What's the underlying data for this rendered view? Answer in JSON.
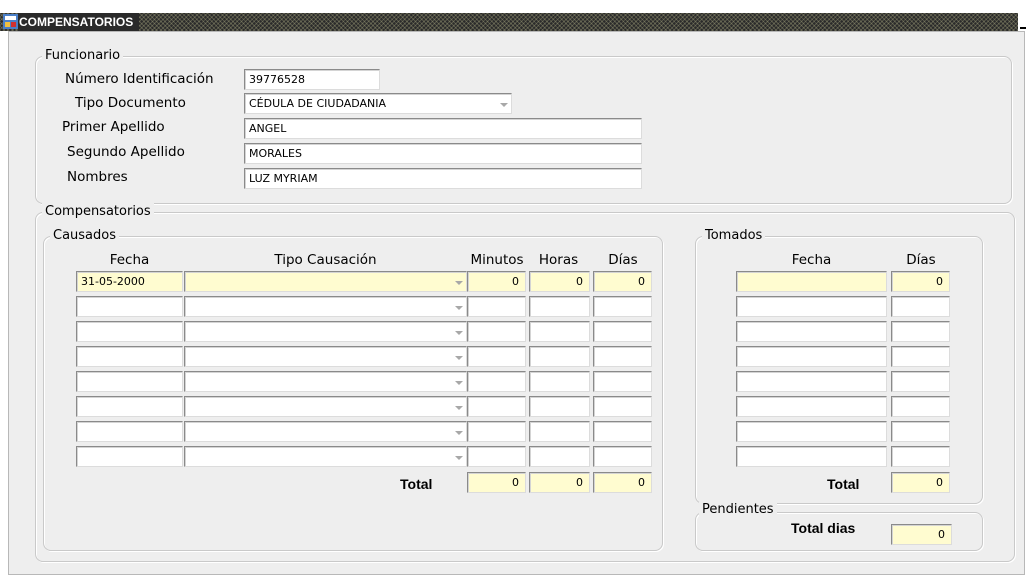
{
  "window": {
    "title": "COMPENSATORIOS"
  },
  "funcionario": {
    "legend": "Funcionario",
    "numero_identificacion": {
      "label": "Número Identificación",
      "value": "39776528"
    },
    "tipo_documento": {
      "label": "Tipo Documento",
      "value": "CÉDULA DE CIUDADANIA"
    },
    "primer_apellido": {
      "label": "Primer Apellido",
      "value": "ANGEL"
    },
    "segundo_apellido": {
      "label": "Segundo Apellido",
      "value": "MORALES"
    },
    "nombres": {
      "label": "Nombres",
      "value": "LUZ MYRIAM"
    }
  },
  "compensatorios": {
    "legend": "Compensatorios",
    "causados": {
      "legend": "Causados",
      "columns": [
        "Fecha",
        "Tipo Causación",
        "Minutos",
        "Horas",
        "Días"
      ],
      "rows": [
        {
          "fecha": "31-05-2000",
          "tipo": "",
          "minutos": "0",
          "horas": "0",
          "dias": "0"
        },
        {
          "fecha": "",
          "tipo": "",
          "minutos": "",
          "horas": "",
          "dias": ""
        },
        {
          "fecha": "",
          "tipo": "",
          "minutos": "",
          "horas": "",
          "dias": ""
        },
        {
          "fecha": "",
          "tipo": "",
          "minutos": "",
          "horas": "",
          "dias": ""
        },
        {
          "fecha": "",
          "tipo": "",
          "minutos": "",
          "horas": "",
          "dias": ""
        },
        {
          "fecha": "",
          "tipo": "",
          "minutos": "",
          "horas": "",
          "dias": ""
        },
        {
          "fecha": "",
          "tipo": "",
          "minutos": "",
          "horas": "",
          "dias": ""
        },
        {
          "fecha": "",
          "tipo": "",
          "minutos": "",
          "horas": "",
          "dias": ""
        }
      ],
      "total": {
        "label": "Total",
        "minutos": "0",
        "horas": "0",
        "dias": "0"
      }
    },
    "tomados": {
      "legend": "Tomados",
      "columns": [
        "Fecha",
        "Días"
      ],
      "rows": [
        {
          "fecha": "",
          "dias": "0"
        },
        {
          "fecha": "",
          "dias": ""
        },
        {
          "fecha": "",
          "dias": ""
        },
        {
          "fecha": "",
          "dias": ""
        },
        {
          "fecha": "",
          "dias": ""
        },
        {
          "fecha": "",
          "dias": ""
        },
        {
          "fecha": "",
          "dias": ""
        },
        {
          "fecha": "",
          "dias": ""
        }
      ],
      "total": {
        "label": "Total",
        "dias": "0"
      }
    },
    "pendientes": {
      "legend": "Pendientes",
      "total_label": "Total dias",
      "total_value": "0"
    }
  },
  "colors": {
    "current_row": "#fffcd0",
    "panel_background": "#eeeeee",
    "title_bar": "#2a2a2a"
  },
  "icons": {
    "app": "oracle-forms-icon",
    "dropdown": "chevron-down-icon"
  }
}
